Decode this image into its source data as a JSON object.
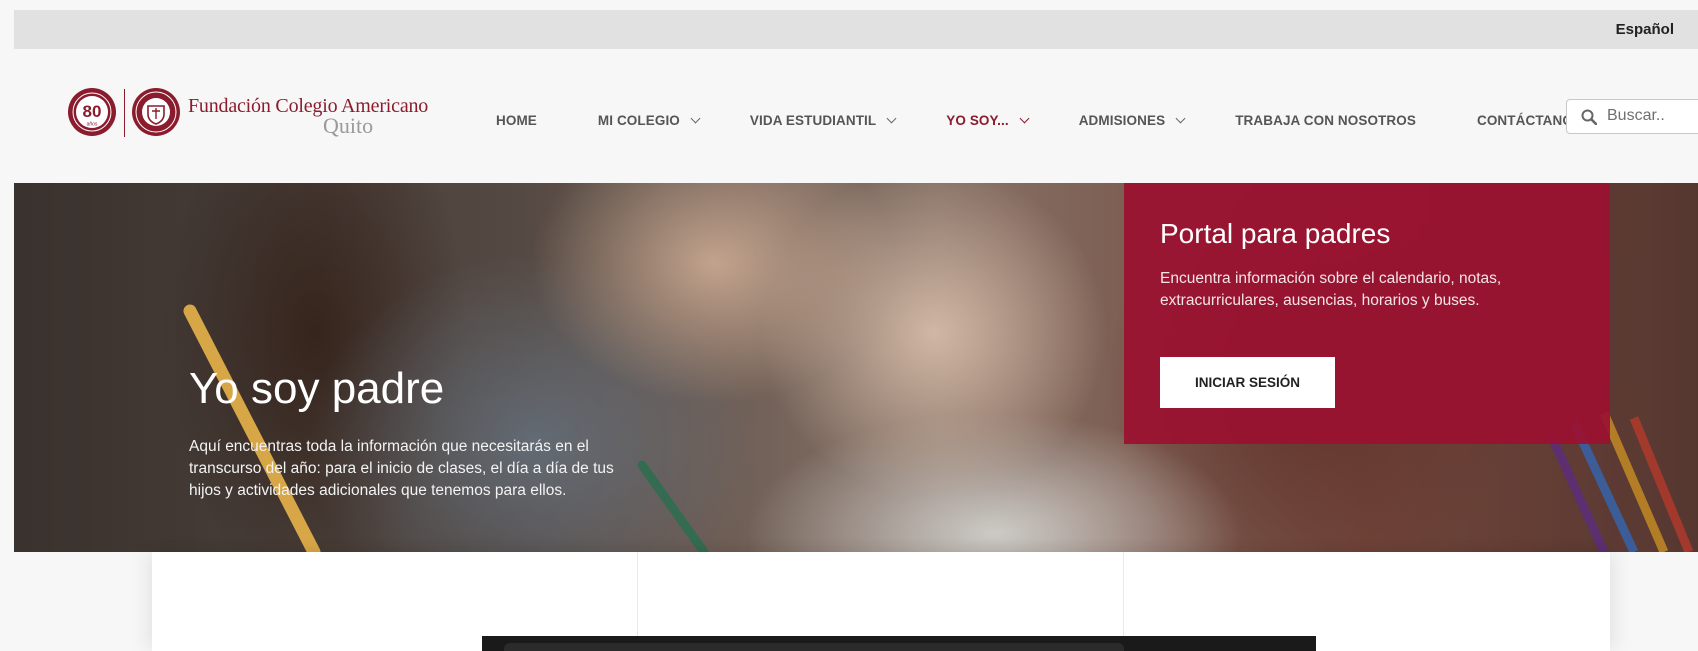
{
  "topbar": {
    "language": "Español"
  },
  "brand": {
    "anniversary_number": "80",
    "anniversary_word": "años",
    "name": "Fundación Colegio Americano",
    "city": "Quito"
  },
  "nav": {
    "items": [
      {
        "label": "HOME",
        "dropdown": false,
        "active": false
      },
      {
        "label": "MI COLEGIO",
        "dropdown": true,
        "active": false
      },
      {
        "label": "VIDA ESTUDIANTIL",
        "dropdown": true,
        "active": false
      },
      {
        "label": "YO SOY...",
        "dropdown": true,
        "active": true
      },
      {
        "label": "ADMISIONES",
        "dropdown": true,
        "active": false
      },
      {
        "label": "TRABAJA CON NOSOTROS",
        "dropdown": false,
        "active": false
      },
      {
        "label": "CONTÁCTANOS",
        "dropdown": false,
        "active": false
      }
    ]
  },
  "search": {
    "placeholder": "Buscar..",
    "icon": "search-icon"
  },
  "hero": {
    "title": "Yo soy padre",
    "description": "Aquí encuentras toda la información que necesitarás en el transcurso del año: para el inicio de clases, el día a día de tus hijos y actividades adicionales que tenemos para ellos."
  },
  "portal": {
    "title": "Portal para padres",
    "description": "Encuentra información sobre el calendario, notas, extracurriculares, ausencias, horarios y buses.",
    "button_label": "INICIAR SESIÓN"
  },
  "colors": {
    "brand": "#8a1c2e",
    "portal_bg": "#9b1130",
    "topbar_bg": "#e1e1e1",
    "page_bg": "#f7f7f7"
  }
}
